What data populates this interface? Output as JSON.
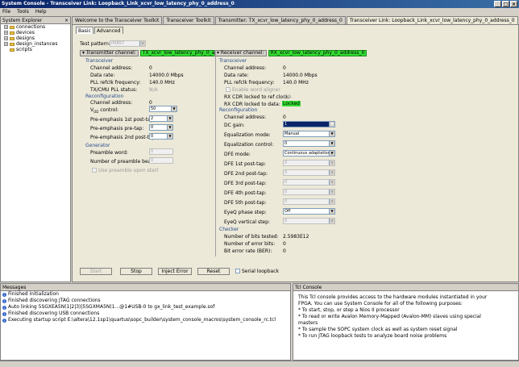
{
  "window": {
    "title": "System Console - Transceiver Link: Loopback_Link_xcvr_low_latency_phy_0_address_0"
  },
  "menu": [
    "File",
    "Tools",
    "Help"
  ],
  "explorer": {
    "title": "System Explorer",
    "items": [
      "connections",
      "devices",
      "designs",
      "design_instances",
      "scripts"
    ]
  },
  "tabs": [
    "Welcome to the Transceiver Toolkit",
    "Transceiver Toolkit",
    "Transmitter: TX_xcvr_low_latency_phy_0_address_0",
    "Transceiver Link: Loopback_Link_xcvr_low_latency_phy_0_address_0"
  ],
  "subtabs": [
    "Basic",
    "Advanced"
  ],
  "test_pattern": {
    "label": "Test pattern:",
    "value": "PRBS7"
  },
  "tx": {
    "channel_btn": "Transmitter channel:",
    "channel_name": "TX_xcvr_low_latency_phy_0_address_0",
    "transceiver_hdr": "Transceiver",
    "rows": [
      {
        "label": "Channel address:",
        "value": "0"
      },
      {
        "label": "Data rate:",
        "value": "14000.0 Mbps"
      },
      {
        "label": "PLL refclk frequency:",
        "value": "140.0 MHz"
      },
      {
        "label": "TX/CMU PLL status:",
        "value": "N/A"
      }
    ],
    "reconfig_hdr": "Reconfiguration",
    "reconfig_addr": {
      "label": "Channel address:",
      "value": "0"
    },
    "vod": {
      "label_v": "V",
      "label_sub": "OD",
      "label_rest": " control:",
      "value": "50"
    },
    "pre1": {
      "label": "Pre-emphasis 1st post-tap:",
      "value": "2"
    },
    "pre0": {
      "label": "Pre-emphasis pre-tap:",
      "value": "0"
    },
    "pre2": {
      "label": "Pre-emphasis 2nd post-tap:",
      "value": "0"
    },
    "generator_hdr": "Generator",
    "preamble_word": {
      "label": "Preamble word:",
      "value": "0"
    },
    "preamble_beats": {
      "label": "Number of preamble beats:",
      "value": "0"
    },
    "use_preamble": "Use preamble upon start"
  },
  "rx": {
    "channel_btn": "Receiver channel:",
    "channel_name": "RX_xcvr_low_latency_phy_0_address_0",
    "transceiver_hdr": "Transceiver",
    "rows": [
      {
        "label": "Channel address:",
        "value": "0"
      },
      {
        "label": "Data rate:",
        "value": "14000.0 Mbps"
      },
      {
        "label": "PLL refclk frequency:",
        "value": "140.0 MHz"
      }
    ],
    "word_aligner": "Enable word aligner",
    "cdr_ref": {
      "label": "RX CDR locked to ref clock:",
      "value": "N/A"
    },
    "cdr_data": {
      "label": "RX CDR locked to data:",
      "value": "Locked"
    },
    "reconfig_hdr": "Reconfiguration",
    "reconfig_addr": {
      "label": "Channel address:",
      "value": "0"
    },
    "dc_gain": {
      "label": "DC gain:",
      "value": "1"
    },
    "eq_mode": {
      "label": "Equalization mode:",
      "value": "Manual"
    },
    "eq_ctrl": {
      "label": "Equalization control:",
      "value": "0"
    },
    "dfe_mode": {
      "label": "DFE mode:",
      "value": "Continuous adaptation"
    },
    "dfe": [
      {
        "label": "DFE 1st post-tap:",
        "value": "0"
      },
      {
        "label": "DFE 2nd post-tap:",
        "value": "0"
      },
      {
        "label": "DFE 3rd post-tap:",
        "value": "0"
      },
      {
        "label": "DFE 4th post-tap:",
        "value": "0"
      },
      {
        "label": "DFE 5th post-tap:",
        "value": "0"
      }
    ],
    "eyeq_phase": {
      "label": "EyeQ phase step:",
      "value": "Off"
    },
    "eyeq_vert": {
      "label": "EyeQ vertical step:",
      "value": "0"
    },
    "checker_hdr": "Checker",
    "bits_tested": {
      "label": "Number of bits tested:",
      "value": "2.5983E12"
    },
    "error_bits": {
      "label": "Number of error bits:",
      "value": "0"
    },
    "ber": {
      "label": "Bit error rate (BER):",
      "value": "0"
    }
  },
  "buttons": {
    "start": "Start",
    "stop": "Stop",
    "inject": "Inject Error",
    "reset": "Reset",
    "serial": "Serial loopback"
  },
  "messages": {
    "title": "Messages",
    "items": [
      "Finished initialization",
      "Finished discovering JTAG connections",
      "Auto linking 5SGXEA5N(1|2|3)|5SGXMA5N(1...@1#USB-0 to gx_link_test_example.sof",
      "Finished discovering USB connections",
      "Executing startup script E:\\altera\\12.1sp1\\quartus\\sopc_builder\\system_console_macros\\system_console_rc.tcl"
    ]
  },
  "tcl": {
    "title": "Tcl Console",
    "lines": [
      "This Tcl console provides access to the hardware modules instantiated in your",
      "FPGA. You can use System Console for all of the following purposes:",
      "",
      "  * To start, stop, or step a Nios II processor",
      "  * To read or write Avalon Memory-Mapped (Avalon-MM) slaves using special",
      "    masters",
      "  * To sample the SOPC system clock as well as system reset signal",
      "  * To run JTAG loopback tests to analyze board noise problems"
    ]
  }
}
